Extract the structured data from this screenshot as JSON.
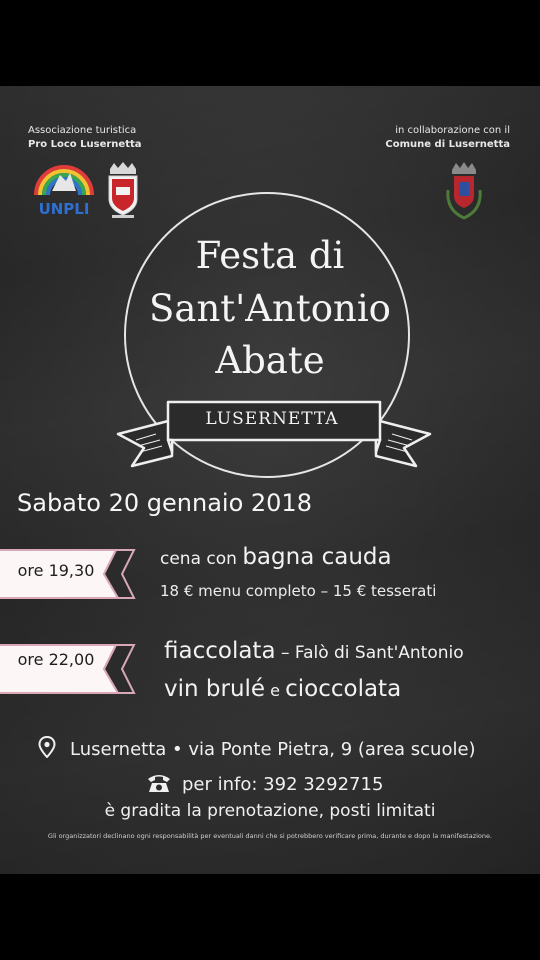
{
  "header": {
    "left_line1": "Associazione turistica",
    "left_line2": "Pro Loco Lusernetta",
    "right_line1": "in collaborazione con il",
    "right_line2": "Comune di Lusernetta",
    "unpli_logo_text": "UNPLI"
  },
  "title": {
    "line1": "Festa di",
    "line2": "Sant'Antonio",
    "line3": "Abate",
    "banner": "LUSERNETTA"
  },
  "date": "Sabato 20 gennaio 2018",
  "events": [
    {
      "time": "ore 19,30",
      "line1_prefix": "cena con ",
      "line1_main": "bagna cauda",
      "line2": "18 € menu completo  –  15 € tesserati"
    },
    {
      "time": "ore 22,00",
      "line1_main": "fiaccolata",
      "line1_suffix": " – Falò di Sant'Antonio",
      "line2_a": "vin brulé",
      "line2_b": " e ",
      "line2_c": "cioccolata"
    }
  ],
  "location": {
    "place": "Lusernetta",
    "separator": " • ",
    "address": "via Ponte Pietra, 9  (area scuole)"
  },
  "contact": {
    "info": "per info: 392 3292715",
    "note": "è gradita la prenotazione, posti limitati"
  },
  "disclaimer": "Gli organizzatori declinano ogni responsabilità per eventuali danni che si potrebbero verificare prima, durante e dopo la manifestazione.",
  "icons": {
    "pin": "map-pin-icon",
    "phone": "telephone-icon"
  },
  "colors": {
    "background": "#2b2b2b",
    "chalk": "#f2f2f2",
    "tag_fill": "#fdf6f6",
    "tag_outline": "#d9a8b8"
  }
}
